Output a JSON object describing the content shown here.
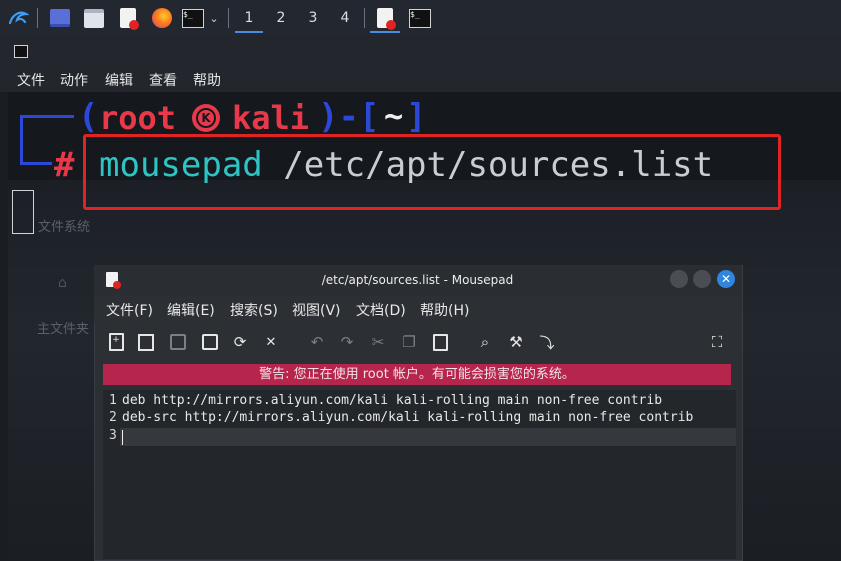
{
  "taskbar": {
    "workspaces": [
      "1",
      "2",
      "3",
      "4"
    ],
    "icons": [
      "kali-dragon-icon",
      "desktop-icon",
      "file-manager-icon",
      "text-editor-icon",
      "firefox-icon",
      "terminal-icon",
      "chevron-down-icon",
      "mousepad-active-icon",
      "terminal-active-icon"
    ]
  },
  "terminal": {
    "menu": [
      "文件",
      "动作",
      "编辑",
      "查看",
      "帮助"
    ],
    "prompt_user": "root",
    "prompt_host": "kali",
    "prompt_dir": "~",
    "prompt_symbol": "#",
    "command": "mousepad /etc/apt/sources.list",
    "bg_text_1": "文件系统",
    "bg_text_2": "主文件夹"
  },
  "mousepad": {
    "title": "/etc/apt/sources.list - Mousepad",
    "menu": [
      "文件(F)",
      "编辑(E)",
      "搜索(S)",
      "视图(V)",
      "文档(D)",
      "帮助(H)"
    ],
    "warning": "警告: 您正在使用 root 帐户。有可能会损害您的系统。",
    "lines": [
      {
        "num": "1",
        "text": "deb http://mirrors.aliyun.com/kali kali-rolling main non-free contrib"
      },
      {
        "num": "2",
        "text": "deb-src http://mirrors.aliyun.com/kali kali-rolling main non-free contrib"
      },
      {
        "num": "3",
        "text": ""
      }
    ]
  },
  "colors": {
    "prompt_red": "#e8394a",
    "prompt_blue": "#2b48d8",
    "command_cyan": "#2ec4c4",
    "highlight_box": "#e02424",
    "warning_bg": "#b6264c"
  }
}
